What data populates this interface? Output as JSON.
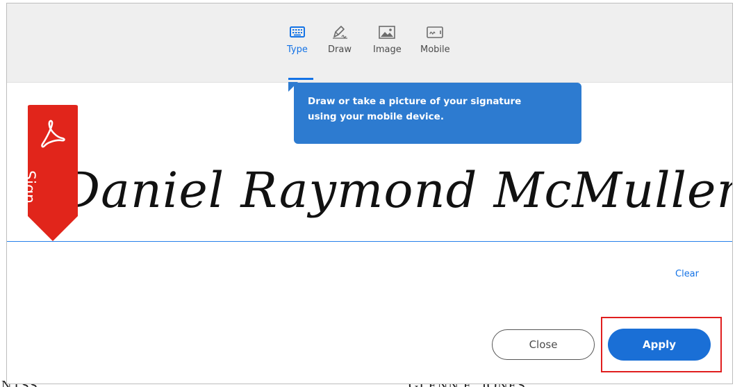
{
  "tabs": [
    {
      "label": "Type",
      "icon": "keyboard-icon",
      "active": true
    },
    {
      "label": "Draw",
      "icon": "pen-draw-icon",
      "active": false
    },
    {
      "label": "Image",
      "icon": "image-icon",
      "active": false
    },
    {
      "label": "Mobile",
      "icon": "mobile-device-icon",
      "active": false
    }
  ],
  "tooltip": {
    "line1": "Draw or take a picture of your signature",
    "line2": "using your mobile device."
  },
  "ribbon": {
    "label": "Sign",
    "icon": "adobe-acrobat-icon",
    "color": "#e1251b"
  },
  "signature": {
    "text": "Daniel Raymond McMullen"
  },
  "actions": {
    "clear_label": "Clear",
    "close_label": "Close",
    "apply_label": "Apply"
  },
  "colors": {
    "accent": "#1473e6",
    "tooltip_bg": "#2d7bd0",
    "apply_bg": "#1a6fd6",
    "highlight": "#e01e1e"
  },
  "background_doc": {
    "left_text": "NTSS",
    "right_text": "GLENN E. JONES"
  }
}
